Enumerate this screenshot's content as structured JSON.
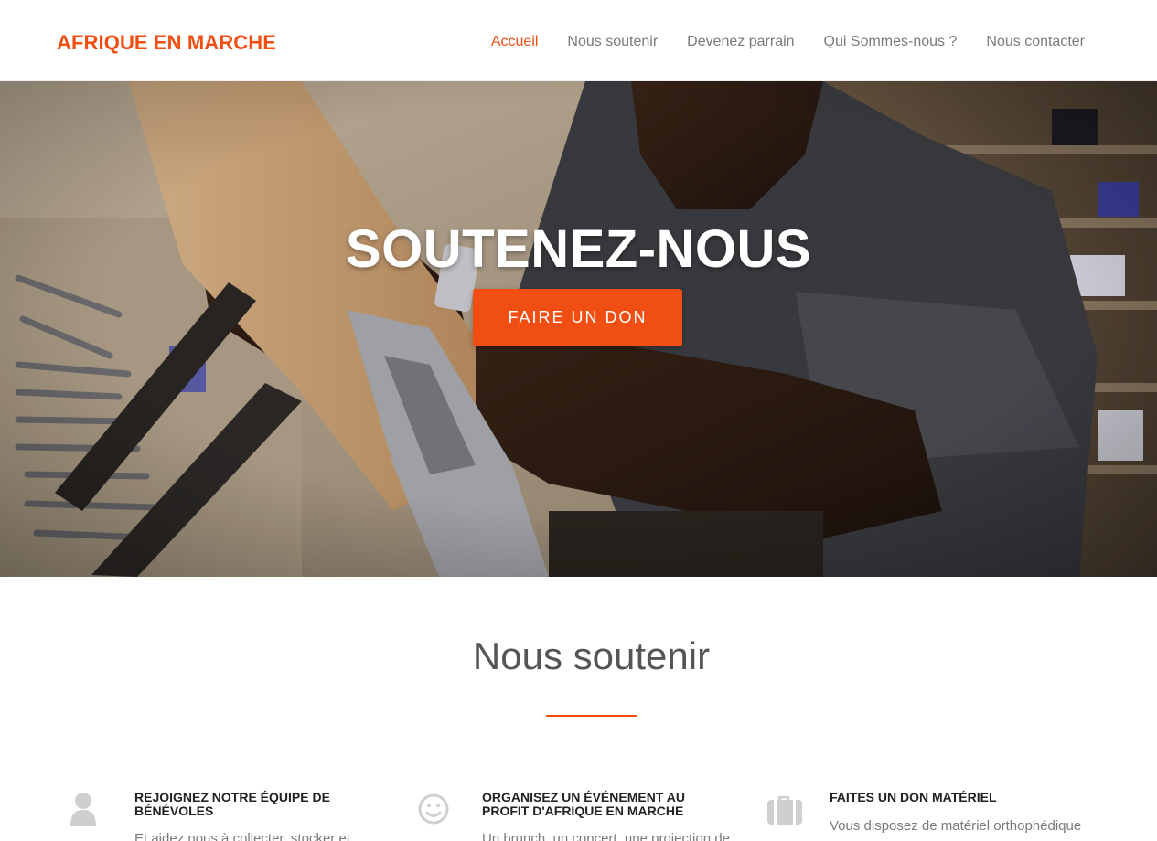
{
  "header": {
    "brand": "AFRIQUE EN MARCHE",
    "nav": [
      {
        "label": "Accueil",
        "active": true
      },
      {
        "label": "Nous soutenir",
        "active": false
      },
      {
        "label": "Devenez parrain",
        "active": false
      },
      {
        "label": "Qui Sommes-nous ?",
        "active": false
      },
      {
        "label": "Nous contacter",
        "active": false
      }
    ]
  },
  "hero": {
    "title": "SOUTENEZ-NOUS",
    "button": "FAIRE UN DON"
  },
  "section": {
    "title": "Nous soutenir",
    "features": [
      {
        "icon": "user-icon",
        "title": "REJOIGNEZ NOTRE ÉQUIPE DE BÉNÉVOLES",
        "text": "Et aidez nous à collecter, stocker et"
      },
      {
        "icon": "smile-icon",
        "title": "ORGANISEZ UN ÉVÉNEMENT AU PROFIT D'AFRIQUE EN MARCHE",
        "text": "Un brunch, un concert, une projection de"
      },
      {
        "icon": "suitcase-icon",
        "title": "FAITES UN DON MATÉRIEL",
        "text": "Vous disposez de matériel orthophédique"
      }
    ]
  },
  "colors": {
    "accent": "#f04e12",
    "text": "#555555",
    "muted": "#7a7a7a"
  }
}
